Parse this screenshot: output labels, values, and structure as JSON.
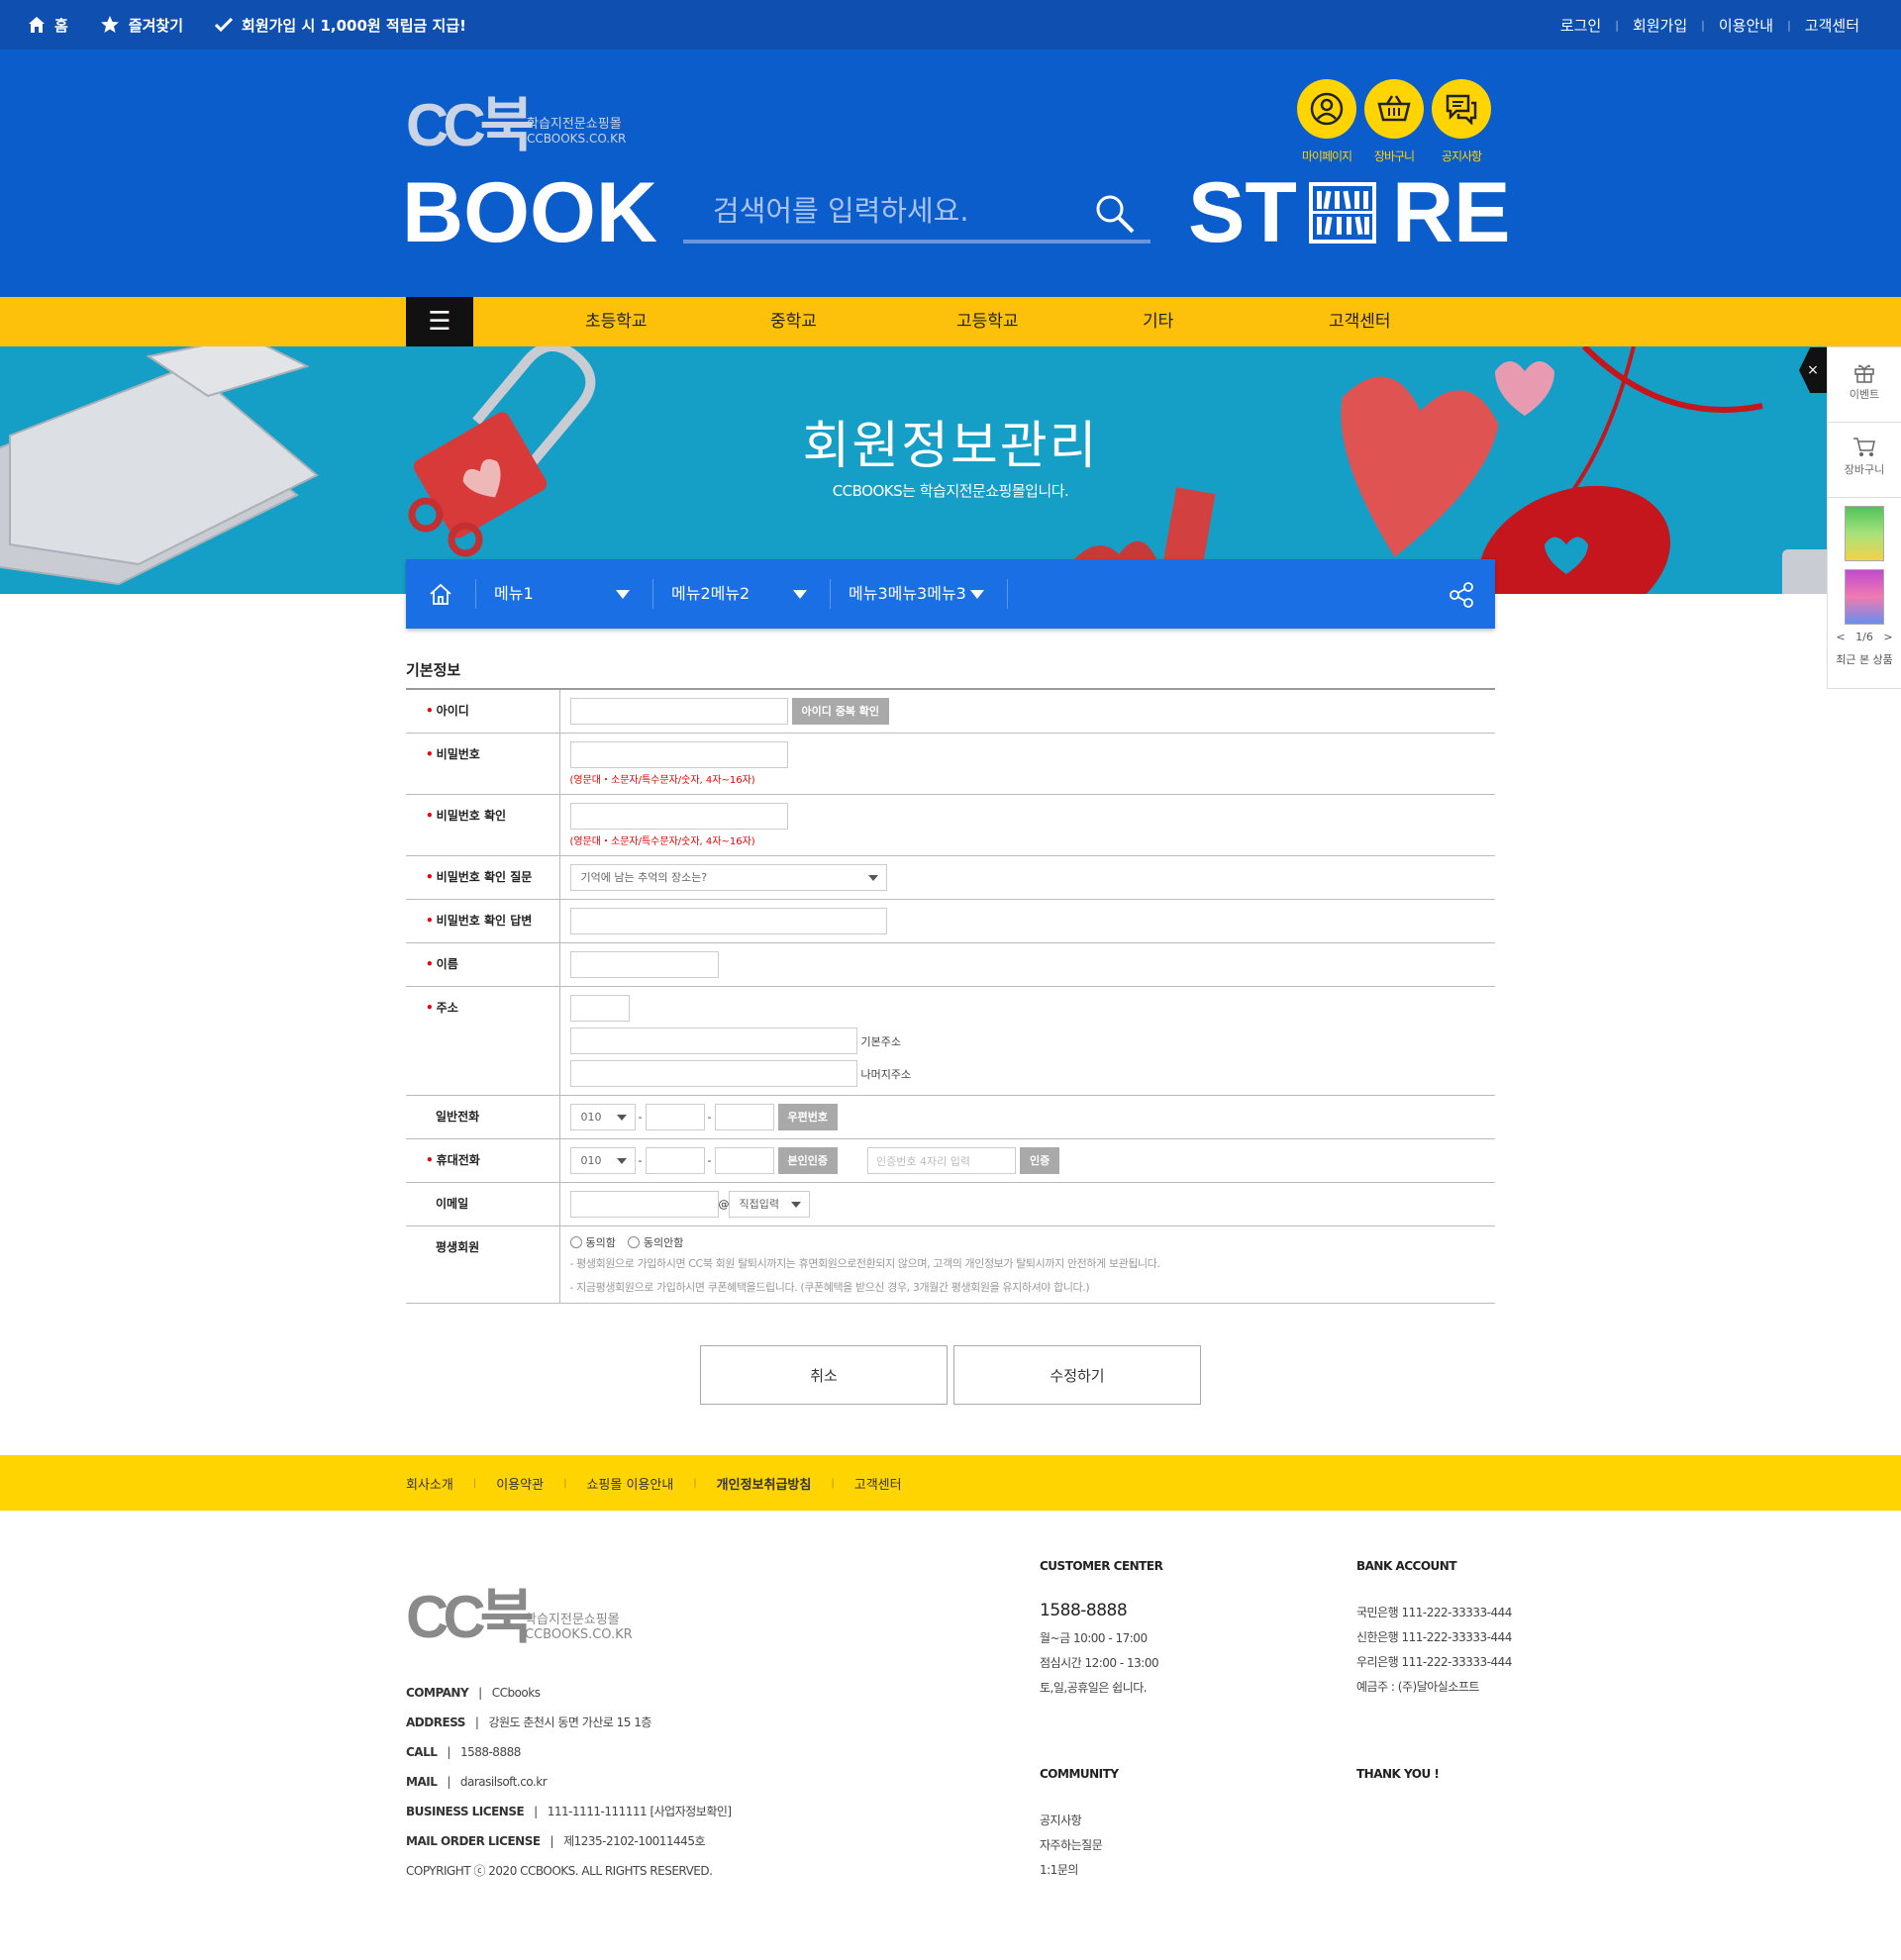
{
  "topbar": {
    "home": "홈",
    "favorite": "즐겨찾기",
    "promo": "회원가입 시 1,000원 적립금 지급!",
    "links": [
      "로그인",
      "회원가입",
      "이용안내",
      "고객센터"
    ]
  },
  "header": {
    "logo_cc": "CC북",
    "logo_sub": "학습지전문쇼핑몰",
    "logo_url": "CCBOOKS.CO.KR",
    "book_word": "BOOK",
    "store_left": "ST",
    "store_right": "RE",
    "search_placeholder": "검색어를 입력하세요.",
    "icons": [
      {
        "icon": "user-icon",
        "label": "마이페이지"
      },
      {
        "icon": "basket-icon",
        "label": "장바구니"
      },
      {
        "icon": "chat-icon",
        "label": "공지사항"
      }
    ],
    "accent": "#ffd400"
  },
  "gnb": {
    "menu_icon": "☰",
    "items": [
      "초등학교",
      "중학교",
      "고등학교",
      "기타",
      "고객센터"
    ]
  },
  "hero": {
    "title": "회원정보관리",
    "subtitle": "CCBOOKS는 학습지전문쇼핑몰입니다."
  },
  "breadcrumb": {
    "items": [
      "메뉴1",
      "메뉴2메뉴2",
      "메뉴3메뉴3메뉴3"
    ]
  },
  "quick_menu": {
    "close": "×",
    "event": "이벤트",
    "cart": "장바구니",
    "page": "1/6",
    "prev": "<",
    "next": ">",
    "recent": "최근 본 상품"
  },
  "form": {
    "section_title": "기본정보",
    "labels": {
      "id": "아이디",
      "password": "비밀번호",
      "password_confirm": "비밀번호 확인",
      "question": "비밀번호 확인 질문",
      "answer": "비밀번호 확인 답변",
      "name": "이름",
      "address": "주소",
      "phone": "일반전화",
      "mobile": "휴대전화",
      "email": "이메일",
      "lifetime": "평생회원"
    },
    "id_check_button": "아이디 중복 확인",
    "password_hint": "(영문대・소문자/특수문자/숫자, 4자~16자)",
    "question_selected": "기억에 남는 추억의 장소는?",
    "address_basic": "기본주소",
    "address_rest": "나머지주소",
    "phone_prefix": "010",
    "zip_button": "우편번호",
    "verify_button": "본인인증",
    "verify_placeholder": "인증번호 4자리 입력",
    "verify_confirm": "인증",
    "email_at": "@",
    "email_domain": "직접입력",
    "agree": "동의함",
    "disagree": "동의안함",
    "notes": [
      "- 평생회원으로 가입하시면 CC북 회원 탈퇴시까지는 휴면회원으로전환되지 않으며, 고객의 개인정보가 탈퇴시까지 안전하게 보관됩니다.",
      "- 지금평생회원으로 가입하시면 쿠폰혜택을드립니다. (쿠폰혜택을 받으신 경우, 3개월간 평생회원을 유지하셔야 합니다.)"
    ],
    "cancel_button": "취소",
    "submit_button": "수정하기"
  },
  "footer": {
    "links": [
      "회사소개",
      "이용약관",
      "쇼핑몰 이용안내",
      "개인정보취급방침",
      "고객센터"
    ],
    "logo_cc": "CC북",
    "logo_sub": "학습지전문쇼핑몰",
    "logo_url": "CCBOOKS.CO.KR",
    "info": [
      {
        "k": "COMPANY",
        "v": "CCbooks"
      },
      {
        "k": "ADDRESS",
        "v": "강원도 춘천시 동면 가산로 15 1층"
      },
      {
        "k": "CALL",
        "v": "1588-8888"
      },
      {
        "k": "MAIL",
        "v": "darasilsoft.co.kr"
      },
      {
        "k": "BUSINESS LICENSE",
        "v": "111-1111-111111 [사업자정보확인]"
      },
      {
        "k": "MAIL ORDER LICENSE",
        "v": "제1235-2102-10011445호"
      }
    ],
    "copyright": "COPYRIGHT ⓒ 2020 CCBOOKS. ALL RIGHTS RESERVED.",
    "customer_center": {
      "title": "CUSTOMER CENTER",
      "phone": "1588-8888",
      "lines": [
        "월~금 10:00 - 17:00",
        "점심시간 12:00 - 13:00",
        "토,일,공휴일은 쉽니다."
      ]
    },
    "bank": {
      "title": "BANK ACCOUNT",
      "lines": [
        "국민은행 111-222-33333-444",
        "신한은행 111-222-33333-444",
        "우리은행 111-222-33333-444",
        "예금주 : (주)달아실소프트"
      ]
    },
    "community": {
      "title": "COMMUNITY",
      "lines": [
        "공지사항",
        "자주하는질문",
        "1:1문의"
      ]
    },
    "thanks": "THANK YOU !"
  }
}
